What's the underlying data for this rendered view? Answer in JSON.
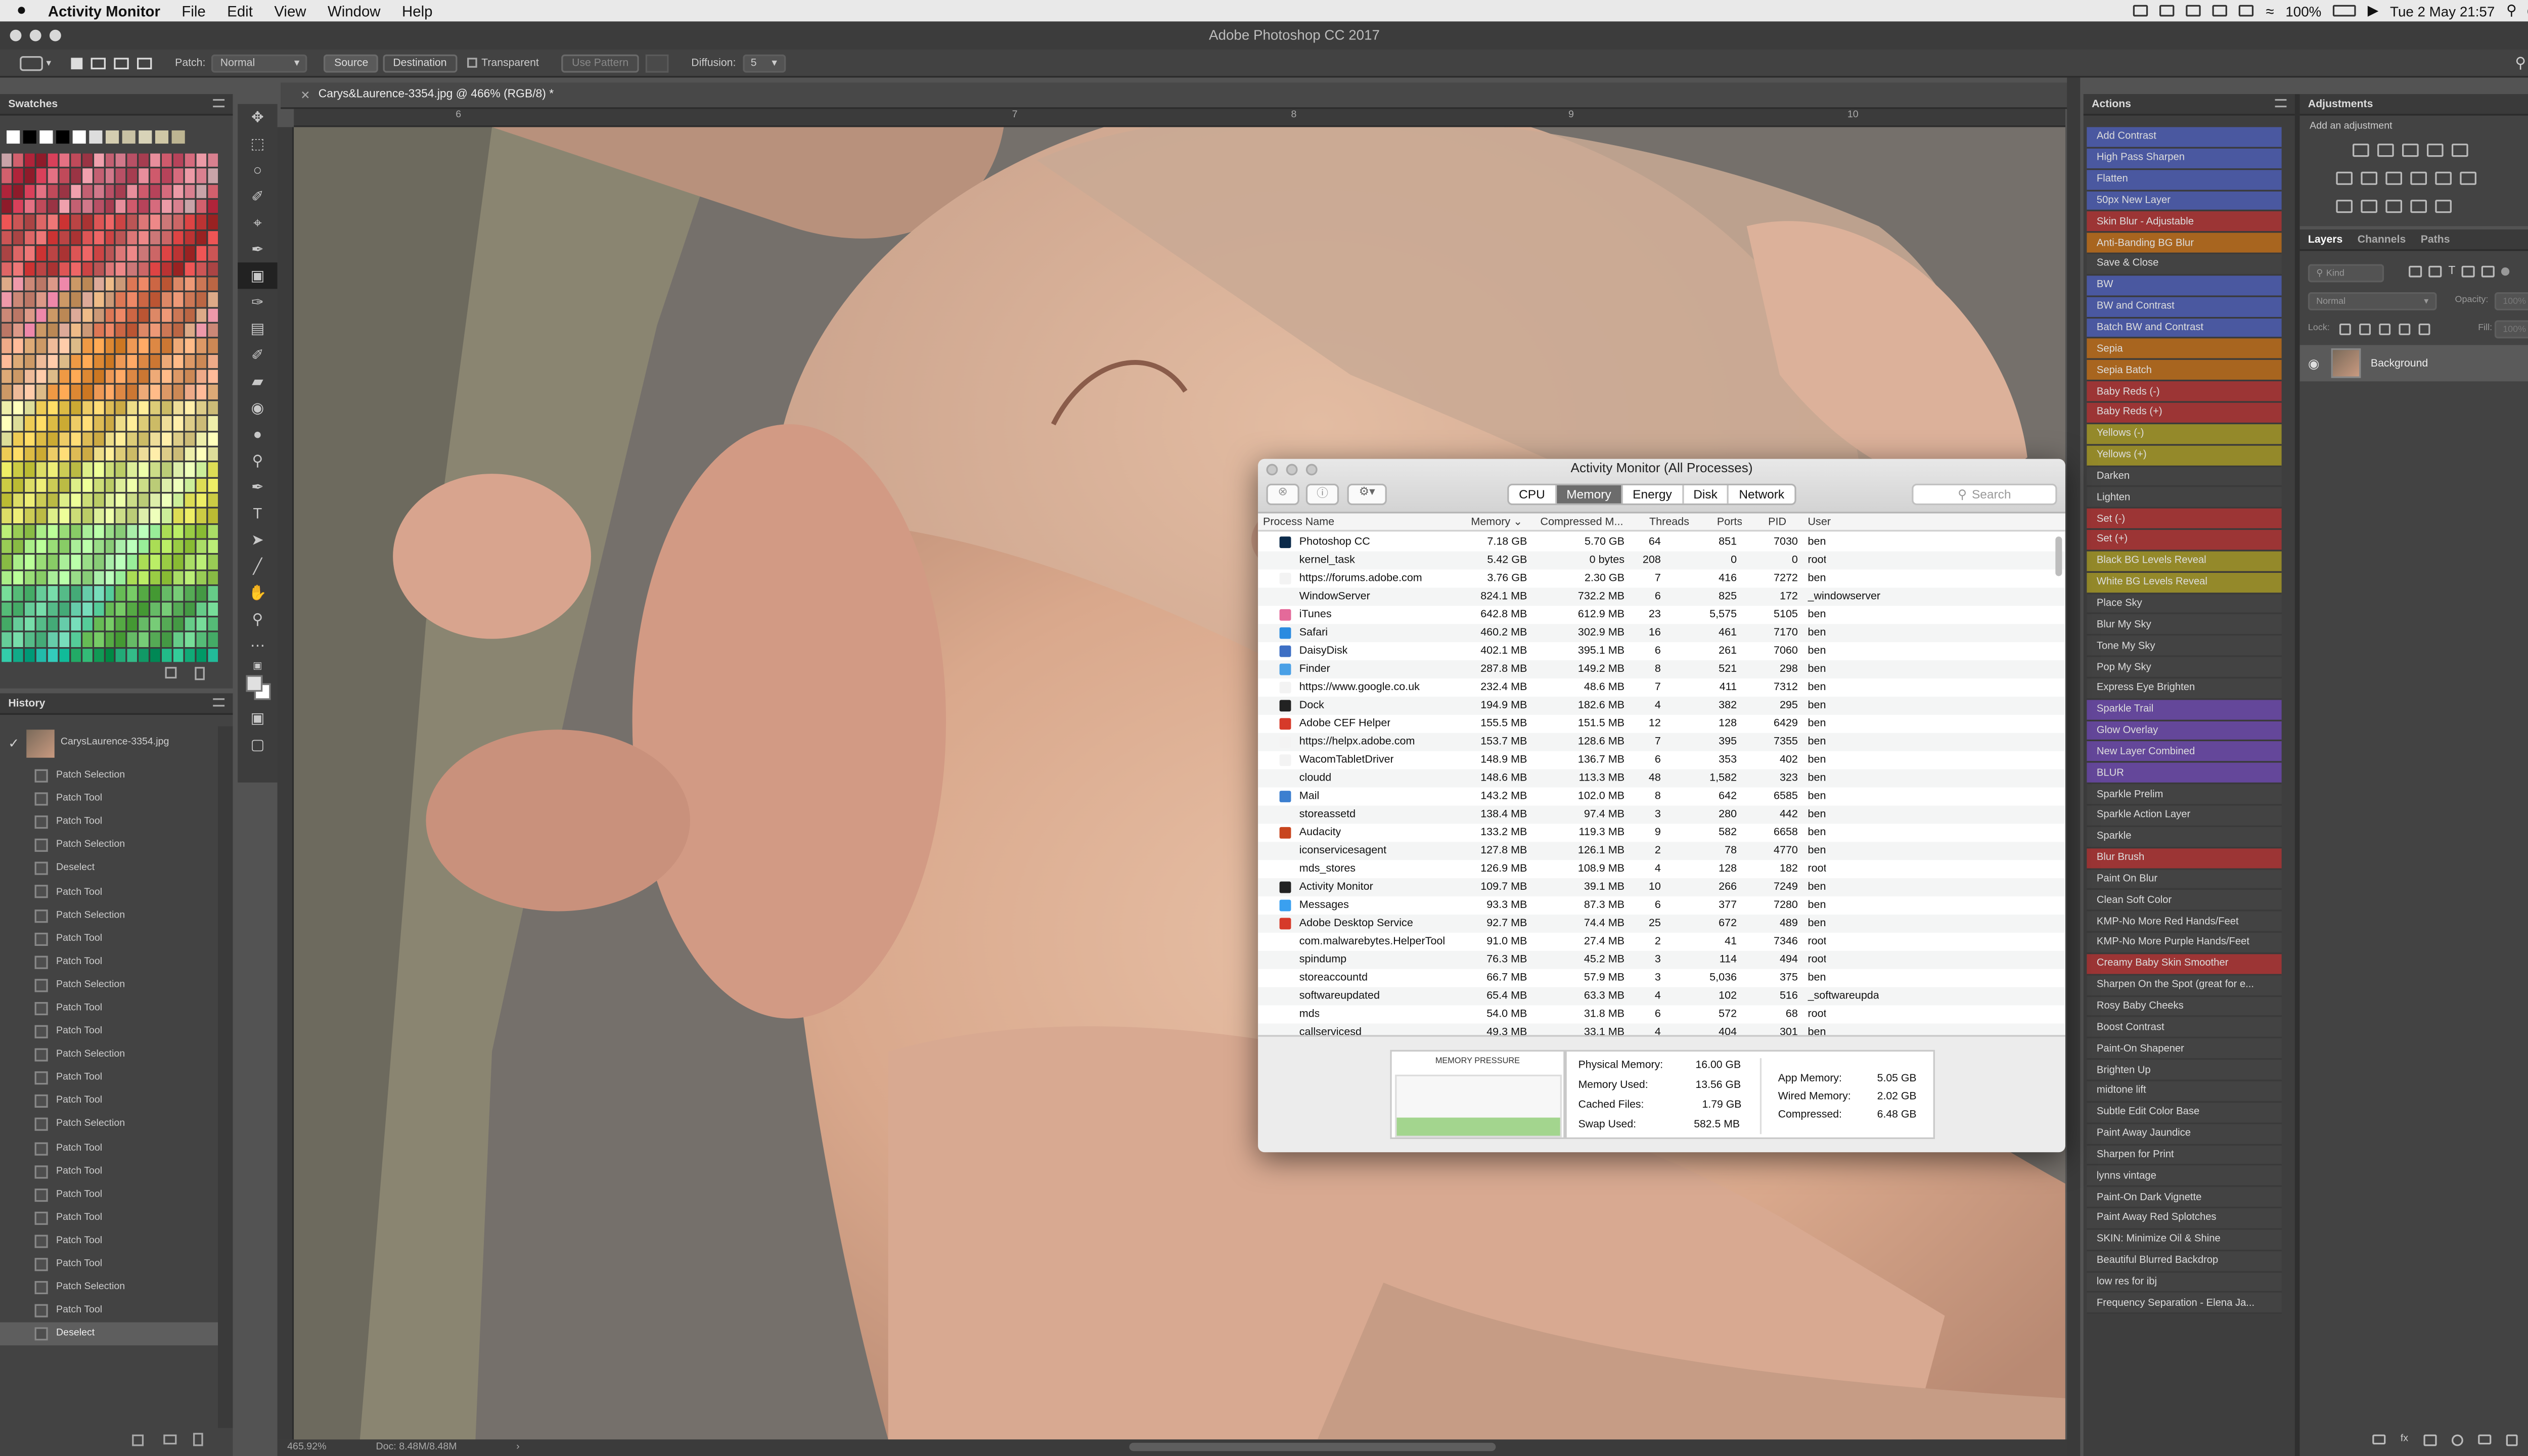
{
  "menubar": {
    "app_name": "Activity Monitor",
    "items": [
      "File",
      "Edit",
      "View",
      "Window",
      "Help"
    ],
    "battery": "100%",
    "clock": "Tue 2 May  21:57"
  },
  "window_title": "Adobe Photoshop CC 2017",
  "options_bar": {
    "patch_label": "Patch:",
    "patch_mode": "Normal",
    "source": "Source",
    "destination": "Destination",
    "transparent": "Transparent",
    "use_pattern": "Use Pattern",
    "diffusion_label": "Diffusion:",
    "diffusion_value": "5"
  },
  "swatches": {
    "title": "Swatches"
  },
  "history": {
    "title": "History",
    "snapshot": "CarysLaurence-3354.jpg",
    "items": [
      "Patch Selection",
      "Patch Tool",
      "Patch Tool",
      "Patch Selection",
      "Deselect",
      "Patch Tool",
      "Patch Selection",
      "Patch Tool",
      "Patch Tool",
      "Patch Selection",
      "Patch Tool",
      "Patch Tool",
      "Patch Selection",
      "Patch Tool",
      "Patch Tool",
      "Patch Selection",
      "Patch Tool",
      "Patch Tool",
      "Patch Tool",
      "Patch Tool",
      "Patch Tool",
      "Patch Tool",
      "Patch Selection",
      "Patch Tool",
      "Deselect"
    ]
  },
  "document": {
    "tab": "Carys&Laurence-3354.jpg @ 466% (RGB/8) *",
    "ruler_marks": [
      "6",
      "7",
      "8",
      "9",
      "10"
    ],
    "zoom": "465.92%",
    "doc_size": "Doc: 8.48M/8.48M"
  },
  "actions": {
    "title": "Actions",
    "items": [
      {
        "label": "Add Contrast",
        "color": "#4a58a0"
      },
      {
        "label": "High Pass Sharpen",
        "color": "#4a58a0"
      },
      {
        "label": "Flatten",
        "color": "#4a58a0"
      },
      {
        "label": "50px New Layer",
        "color": "#4a58a0"
      },
      {
        "label": "Skin Blur - Adjustable",
        "color": "#9c3535"
      },
      {
        "label": "Anti-Banding BG Blur",
        "color": "#a8651f"
      },
      {
        "label": "Save & Close",
        "color": ""
      },
      {
        "label": "BW",
        "color": "#4a58a0"
      },
      {
        "label": "BW and Contrast",
        "color": "#4a58a0"
      },
      {
        "label": "Batch BW and Contrast",
        "color": "#4a58a0"
      },
      {
        "label": "Sepia",
        "color": "#a8651f"
      },
      {
        "label": "Sepia Batch",
        "color": "#a8651f"
      },
      {
        "label": "Baby Reds (-)",
        "color": "#9c3535"
      },
      {
        "label": "Baby Reds (+)",
        "color": "#9c3535"
      },
      {
        "label": "Yellows (-)",
        "color": "#94892a"
      },
      {
        "label": "Yellows (+)",
        "color": "#94892a"
      },
      {
        "label": "Darken",
        "color": ""
      },
      {
        "label": "Lighten",
        "color": ""
      },
      {
        "label": "Set (-)",
        "color": "#9c3535"
      },
      {
        "label": "Set (+)",
        "color": "#9c3535"
      },
      {
        "label": "Black BG Levels Reveal",
        "color": "#94892a"
      },
      {
        "label": "White BG Levels Reveal",
        "color": "#94892a"
      },
      {
        "label": "Place Sky",
        "color": ""
      },
      {
        "label": "Blur My Sky",
        "color": ""
      },
      {
        "label": "Tone My Sky",
        "color": ""
      },
      {
        "label": "Pop My Sky",
        "color": ""
      },
      {
        "label": "Express Eye Brighten",
        "color": ""
      },
      {
        "label": "Sparkle Trail",
        "color": "#64479a"
      },
      {
        "label": "Glow Overlay",
        "color": "#64479a"
      },
      {
        "label": "New Layer Combined",
        "color": "#64479a"
      },
      {
        "label": "BLUR",
        "color": "#64479a"
      },
      {
        "label": "Sparkle Prelim",
        "color": ""
      },
      {
        "label": "Sparkle Action Layer",
        "color": ""
      },
      {
        "label": "Sparkle",
        "color": ""
      },
      {
        "label": "Blur Brush",
        "color": "#9c3535"
      },
      {
        "label": "Paint On Blur",
        "color": ""
      },
      {
        "label": "Clean Soft Color",
        "color": ""
      },
      {
        "label": "KMP-No More Red Hands/Feet",
        "color": ""
      },
      {
        "label": "KMP-No More Purple Hands/Feet",
        "color": ""
      },
      {
        "label": "Creamy Baby Skin Smoother",
        "color": "#9c3535"
      },
      {
        "label": "Sharpen On the Spot (great for e...",
        "color": ""
      },
      {
        "label": "Rosy Baby Cheeks",
        "color": ""
      },
      {
        "label": "Boost Contrast",
        "color": ""
      },
      {
        "label": "Paint-On Shapener",
        "color": ""
      },
      {
        "label": "Brighten Up",
        "color": ""
      },
      {
        "label": "midtone lift",
        "color": ""
      },
      {
        "label": "Subtle Edit Color Base",
        "color": ""
      },
      {
        "label": "Paint Away Jaundice",
        "color": ""
      },
      {
        "label": "Sharpen for Print",
        "color": ""
      },
      {
        "label": "lynns vintage",
        "color": ""
      },
      {
        "label": "Paint-On Dark Vignette",
        "color": ""
      },
      {
        "label": "Paint Away Red Splotches",
        "color": ""
      },
      {
        "label": "SKIN: Minimize Oil & Shine",
        "color": ""
      },
      {
        "label": "Beautiful Blurred Backdrop",
        "color": ""
      },
      {
        "label": "low res for ibj",
        "color": ""
      },
      {
        "label": "Frequency Separation - Elena Ja...",
        "color": ""
      }
    ]
  },
  "adjustments": {
    "title": "Adjustments",
    "subtitle": "Add an adjustment"
  },
  "layers": {
    "tabs": [
      "Layers",
      "Channels",
      "Paths"
    ],
    "kind": "Kind",
    "blend": "Normal",
    "opacity_label": "Opacity:",
    "opacity_value": "100%",
    "lock_label": "Lock:",
    "fill_label": "Fill:",
    "fill_value": "100%",
    "layer_name": "Background"
  },
  "activity_monitor": {
    "title": "Activity Monitor (All Processes)",
    "tabs": [
      "CPU",
      "Memory",
      "Energy",
      "Disk",
      "Network"
    ],
    "active_tab": "Memory",
    "search_placeholder": "Search",
    "columns": [
      "Process Name",
      "Memory ⌄",
      "Compressed M...",
      "Threads",
      "Ports",
      "PID",
      "User"
    ],
    "rows": [
      {
        "name": "Photoshop CC",
        "mem": "7.18 GB",
        "comp": "5.70 GB",
        "threads": "64",
        "ports": "851",
        "pid": "7030",
        "user": "ben",
        "icon": "#0b2a4a"
      },
      {
        "name": "kernel_task",
        "mem": "5.42 GB",
        "comp": "0 bytes",
        "threads": "208",
        "ports": "0",
        "pid": "0",
        "user": "root",
        "icon": ""
      },
      {
        "name": "https://forums.adobe.com",
        "mem": "3.76 GB",
        "comp": "2.30 GB",
        "threads": "7",
        "ports": "416",
        "pid": "7272",
        "user": "ben",
        "icon": "#f3f3f3"
      },
      {
        "name": "WindowServer",
        "mem": "824.1 MB",
        "comp": "732.2 MB",
        "threads": "6",
        "ports": "825",
        "pid": "172",
        "user": "_windowserver",
        "icon": ""
      },
      {
        "name": "iTunes",
        "mem": "642.8 MB",
        "comp": "612.9 MB",
        "threads": "23",
        "ports": "5,575",
        "pid": "5105",
        "user": "ben",
        "icon": "#e46a9a"
      },
      {
        "name": "Safari",
        "mem": "460.2 MB",
        "comp": "302.9 MB",
        "threads": "16",
        "ports": "461",
        "pid": "7170",
        "user": "ben",
        "icon": "#2b8be0"
      },
      {
        "name": "DaisyDisk",
        "mem": "402.1 MB",
        "comp": "395.1 MB",
        "threads": "6",
        "ports": "261",
        "pid": "7060",
        "user": "ben",
        "icon": "#3d6fc4"
      },
      {
        "name": "Finder",
        "mem": "287.8 MB",
        "comp": "149.2 MB",
        "threads": "8",
        "ports": "521",
        "pid": "298",
        "user": "ben",
        "icon": "#4aa0e6"
      },
      {
        "name": "https://www.google.co.uk",
        "mem": "232.4 MB",
        "comp": "48.6 MB",
        "threads": "7",
        "ports": "411",
        "pid": "7312",
        "user": "ben",
        "icon": "#f3f3f3"
      },
      {
        "name": "Dock",
        "mem": "194.9 MB",
        "comp": "182.6 MB",
        "threads": "4",
        "ports": "382",
        "pid": "295",
        "user": "ben",
        "icon": "#222"
      },
      {
        "name": "Adobe CEF Helper",
        "mem": "155.5 MB",
        "comp": "151.5 MB",
        "threads": "12",
        "ports": "128",
        "pid": "6429",
        "user": "ben",
        "icon": "#d63a2a"
      },
      {
        "name": "https://helpx.adobe.com",
        "mem": "153.7 MB",
        "comp": "128.6 MB",
        "threads": "7",
        "ports": "395",
        "pid": "7355",
        "user": "ben",
        "icon": "#f3f3f3"
      },
      {
        "name": "WacomTabletDriver",
        "mem": "148.9 MB",
        "comp": "136.7 MB",
        "threads": "6",
        "ports": "353",
        "pid": "402",
        "user": "ben",
        "icon": "#f3f3f3"
      },
      {
        "name": "cloudd",
        "mem": "148.6 MB",
        "comp": "113.3 MB",
        "threads": "48",
        "ports": "1,582",
        "pid": "323",
        "user": "ben",
        "icon": ""
      },
      {
        "name": "Mail",
        "mem": "143.2 MB",
        "comp": "102.0 MB",
        "threads": "8",
        "ports": "642",
        "pid": "6585",
        "user": "ben",
        "icon": "#3c7fd0"
      },
      {
        "name": "storeassetd",
        "mem": "138.4 MB",
        "comp": "97.4 MB",
        "threads": "3",
        "ports": "280",
        "pid": "442",
        "user": "ben",
        "icon": ""
      },
      {
        "name": "Audacity",
        "mem": "133.2 MB",
        "comp": "119.3 MB",
        "threads": "9",
        "ports": "582",
        "pid": "6658",
        "user": "ben",
        "icon": "#c8451e"
      },
      {
        "name": "iconservicesagent",
        "mem": "127.8 MB",
        "comp": "126.1 MB",
        "threads": "2",
        "ports": "78",
        "pid": "4770",
        "user": "ben",
        "icon": ""
      },
      {
        "name": "mds_stores",
        "mem": "126.9 MB",
        "comp": "108.9 MB",
        "threads": "4",
        "ports": "128",
        "pid": "182",
        "user": "root",
        "icon": ""
      },
      {
        "name": "Activity Monitor",
        "mem": "109.7 MB",
        "comp": "39.1 MB",
        "threads": "10",
        "ports": "266",
        "pid": "7249",
        "user": "ben",
        "icon": "#222"
      },
      {
        "name": "Messages",
        "mem": "93.3 MB",
        "comp": "87.3 MB",
        "threads": "6",
        "ports": "377",
        "pid": "7280",
        "user": "ben",
        "icon": "#3aa0f0"
      },
      {
        "name": "Adobe Desktop Service",
        "mem": "92.7 MB",
        "comp": "74.4 MB",
        "threads": "25",
        "ports": "672",
        "pid": "489",
        "user": "ben",
        "icon": "#d63a2a"
      },
      {
        "name": "com.malwarebytes.HelperTool",
        "mem": "91.0 MB",
        "comp": "27.4 MB",
        "threads": "2",
        "ports": "41",
        "pid": "7346",
        "user": "root",
        "icon": ""
      },
      {
        "name": "spindump",
        "mem": "76.3 MB",
        "comp": "45.2 MB",
        "threads": "3",
        "ports": "114",
        "pid": "494",
        "user": "root",
        "icon": ""
      },
      {
        "name": "storeaccountd",
        "mem": "66.7 MB",
        "comp": "57.9 MB",
        "threads": "3",
        "ports": "5,036",
        "pid": "375",
        "user": "ben",
        "icon": ""
      },
      {
        "name": "softwareupdated",
        "mem": "65.4 MB",
        "comp": "63.3 MB",
        "threads": "4",
        "ports": "102",
        "pid": "516",
        "user": "_softwareupda",
        "icon": ""
      },
      {
        "name": "mds",
        "mem": "54.0 MB",
        "comp": "31.8 MB",
        "threads": "6",
        "ports": "572",
        "pid": "68",
        "user": "root",
        "icon": ""
      },
      {
        "name": "callservicesd",
        "mem": "49.3 MB",
        "comp": "33.1 MB",
        "threads": "4",
        "ports": "404",
        "pid": "301",
        "user": "ben",
        "icon": ""
      }
    ],
    "memory_pressure_label": "MEMORY PRESSURE",
    "memory_pressure_level": 0.3,
    "stats": {
      "physical_label": "Physical Memory:",
      "physical": "16.00 GB",
      "used_label": "Memory Used:",
      "used": "13.56 GB",
      "cached_label": "Cached Files:",
      "cached": "1.79 GB",
      "swap_label": "Swap Used:",
      "swap": "582.5 MB",
      "app_label": "App Memory:",
      "app": "5.05 GB",
      "wired_label": "Wired Memory:",
      "wired": "2.02 GB",
      "compressed_label": "Compressed:",
      "compressed": "6.48 GB"
    }
  }
}
